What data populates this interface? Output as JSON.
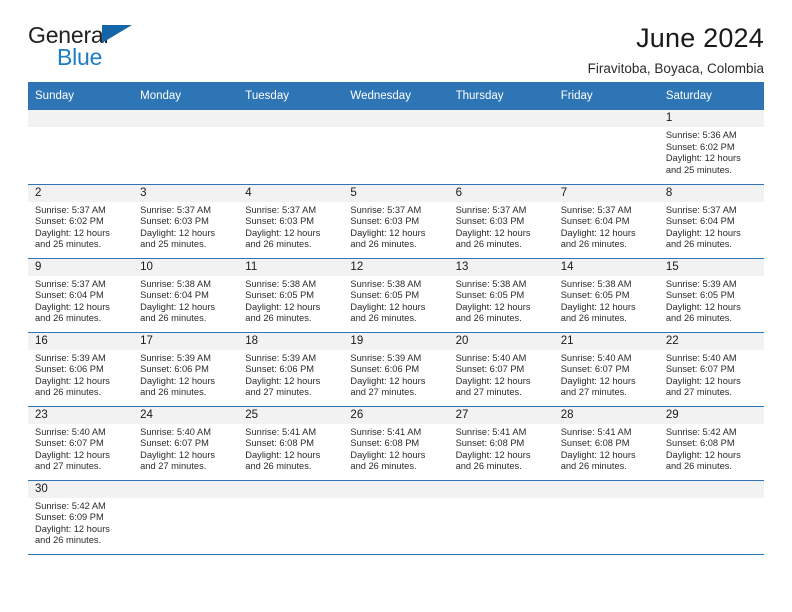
{
  "brand": {
    "name_top": "General",
    "name_bottom": "Blue",
    "accent_color": "#1b7dc4",
    "flag_color": "#1466a8"
  },
  "header": {
    "title": "June 2024",
    "subtitle": "Firavitoba, Boyaca, Colombia"
  },
  "calendar": {
    "header_bg": "#2e75b6",
    "daynum_bg": "#f2f2f2",
    "weekdays": [
      "Sunday",
      "Monday",
      "Tuesday",
      "Wednesday",
      "Thursday",
      "Friday",
      "Saturday"
    ],
    "weeks": [
      [
        {
          "blank": true
        },
        {
          "blank": true
        },
        {
          "blank": true
        },
        {
          "blank": true
        },
        {
          "blank": true
        },
        {
          "blank": true
        },
        {
          "day": "1",
          "sunrise": "Sunrise: 5:36 AM",
          "sunset": "Sunset: 6:02 PM",
          "daylight_1": "Daylight: 12 hours",
          "daylight_2": "and 25 minutes."
        }
      ],
      [
        {
          "day": "2",
          "sunrise": "Sunrise: 5:37 AM",
          "sunset": "Sunset: 6:02 PM",
          "daylight_1": "Daylight: 12 hours",
          "daylight_2": "and 25 minutes."
        },
        {
          "day": "3",
          "sunrise": "Sunrise: 5:37 AM",
          "sunset": "Sunset: 6:03 PM",
          "daylight_1": "Daylight: 12 hours",
          "daylight_2": "and 25 minutes."
        },
        {
          "day": "4",
          "sunrise": "Sunrise: 5:37 AM",
          "sunset": "Sunset: 6:03 PM",
          "daylight_1": "Daylight: 12 hours",
          "daylight_2": "and 26 minutes."
        },
        {
          "day": "5",
          "sunrise": "Sunrise: 5:37 AM",
          "sunset": "Sunset: 6:03 PM",
          "daylight_1": "Daylight: 12 hours",
          "daylight_2": "and 26 minutes."
        },
        {
          "day": "6",
          "sunrise": "Sunrise: 5:37 AM",
          "sunset": "Sunset: 6:03 PM",
          "daylight_1": "Daylight: 12 hours",
          "daylight_2": "and 26 minutes."
        },
        {
          "day": "7",
          "sunrise": "Sunrise: 5:37 AM",
          "sunset": "Sunset: 6:04 PM",
          "daylight_1": "Daylight: 12 hours",
          "daylight_2": "and 26 minutes."
        },
        {
          "day": "8",
          "sunrise": "Sunrise: 5:37 AM",
          "sunset": "Sunset: 6:04 PM",
          "daylight_1": "Daylight: 12 hours",
          "daylight_2": "and 26 minutes."
        }
      ],
      [
        {
          "day": "9",
          "sunrise": "Sunrise: 5:37 AM",
          "sunset": "Sunset: 6:04 PM",
          "daylight_1": "Daylight: 12 hours",
          "daylight_2": "and 26 minutes."
        },
        {
          "day": "10",
          "sunrise": "Sunrise: 5:38 AM",
          "sunset": "Sunset: 6:04 PM",
          "daylight_1": "Daylight: 12 hours",
          "daylight_2": "and 26 minutes."
        },
        {
          "day": "11",
          "sunrise": "Sunrise: 5:38 AM",
          "sunset": "Sunset: 6:05 PM",
          "daylight_1": "Daylight: 12 hours",
          "daylight_2": "and 26 minutes."
        },
        {
          "day": "12",
          "sunrise": "Sunrise: 5:38 AM",
          "sunset": "Sunset: 6:05 PM",
          "daylight_1": "Daylight: 12 hours",
          "daylight_2": "and 26 minutes."
        },
        {
          "day": "13",
          "sunrise": "Sunrise: 5:38 AM",
          "sunset": "Sunset: 6:05 PM",
          "daylight_1": "Daylight: 12 hours",
          "daylight_2": "and 26 minutes."
        },
        {
          "day": "14",
          "sunrise": "Sunrise: 5:38 AM",
          "sunset": "Sunset: 6:05 PM",
          "daylight_1": "Daylight: 12 hours",
          "daylight_2": "and 26 minutes."
        },
        {
          "day": "15",
          "sunrise": "Sunrise: 5:39 AM",
          "sunset": "Sunset: 6:05 PM",
          "daylight_1": "Daylight: 12 hours",
          "daylight_2": "and 26 minutes."
        }
      ],
      [
        {
          "day": "16",
          "sunrise": "Sunrise: 5:39 AM",
          "sunset": "Sunset: 6:06 PM",
          "daylight_1": "Daylight: 12 hours",
          "daylight_2": "and 26 minutes."
        },
        {
          "day": "17",
          "sunrise": "Sunrise: 5:39 AM",
          "sunset": "Sunset: 6:06 PM",
          "daylight_1": "Daylight: 12 hours",
          "daylight_2": "and 26 minutes."
        },
        {
          "day": "18",
          "sunrise": "Sunrise: 5:39 AM",
          "sunset": "Sunset: 6:06 PM",
          "daylight_1": "Daylight: 12 hours",
          "daylight_2": "and 27 minutes."
        },
        {
          "day": "19",
          "sunrise": "Sunrise: 5:39 AM",
          "sunset": "Sunset: 6:06 PM",
          "daylight_1": "Daylight: 12 hours",
          "daylight_2": "and 27 minutes."
        },
        {
          "day": "20",
          "sunrise": "Sunrise: 5:40 AM",
          "sunset": "Sunset: 6:07 PM",
          "daylight_1": "Daylight: 12 hours",
          "daylight_2": "and 27 minutes."
        },
        {
          "day": "21",
          "sunrise": "Sunrise: 5:40 AM",
          "sunset": "Sunset: 6:07 PM",
          "daylight_1": "Daylight: 12 hours",
          "daylight_2": "and 27 minutes."
        },
        {
          "day": "22",
          "sunrise": "Sunrise: 5:40 AM",
          "sunset": "Sunset: 6:07 PM",
          "daylight_1": "Daylight: 12 hours",
          "daylight_2": "and 27 minutes."
        }
      ],
      [
        {
          "day": "23",
          "sunrise": "Sunrise: 5:40 AM",
          "sunset": "Sunset: 6:07 PM",
          "daylight_1": "Daylight: 12 hours",
          "daylight_2": "and 27 minutes."
        },
        {
          "day": "24",
          "sunrise": "Sunrise: 5:40 AM",
          "sunset": "Sunset: 6:07 PM",
          "daylight_1": "Daylight: 12 hours",
          "daylight_2": "and 27 minutes."
        },
        {
          "day": "25",
          "sunrise": "Sunrise: 5:41 AM",
          "sunset": "Sunset: 6:08 PM",
          "daylight_1": "Daylight: 12 hours",
          "daylight_2": "and 26 minutes."
        },
        {
          "day": "26",
          "sunrise": "Sunrise: 5:41 AM",
          "sunset": "Sunset: 6:08 PM",
          "daylight_1": "Daylight: 12 hours",
          "daylight_2": "and 26 minutes."
        },
        {
          "day": "27",
          "sunrise": "Sunrise: 5:41 AM",
          "sunset": "Sunset: 6:08 PM",
          "daylight_1": "Daylight: 12 hours",
          "daylight_2": "and 26 minutes."
        },
        {
          "day": "28",
          "sunrise": "Sunrise: 5:41 AM",
          "sunset": "Sunset: 6:08 PM",
          "daylight_1": "Daylight: 12 hours",
          "daylight_2": "and 26 minutes."
        },
        {
          "day": "29",
          "sunrise": "Sunrise: 5:42 AM",
          "sunset": "Sunset: 6:08 PM",
          "daylight_1": "Daylight: 12 hours",
          "daylight_2": "and 26 minutes."
        }
      ],
      [
        {
          "day": "30",
          "sunrise": "Sunrise: 5:42 AM",
          "sunset": "Sunset: 6:09 PM",
          "daylight_1": "Daylight: 12 hours",
          "daylight_2": "and 26 minutes."
        },
        {
          "blank": true
        },
        {
          "blank": true
        },
        {
          "blank": true
        },
        {
          "blank": true
        },
        {
          "blank": true
        },
        {
          "blank": true
        }
      ]
    ]
  }
}
